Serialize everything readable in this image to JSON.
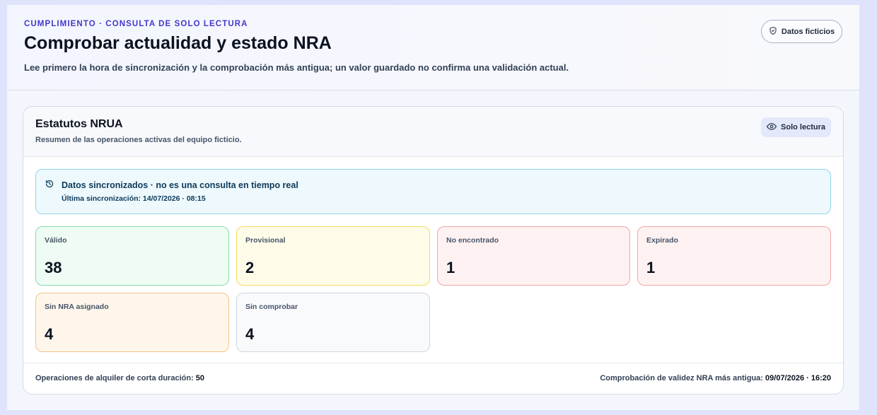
{
  "header": {
    "eyebrow": "CUMPLIMIENTO · CONSULTA DE SOLO LECTURA",
    "title": "Comprobar actualidad y estado NRA",
    "subtitle": "Lee primero la hora de sincronización y la comprobación más antigua; un valor guardado no confirma una validación actual.",
    "data_badge": "Datos ficticios",
    "data_badge_icon": "shield-icon"
  },
  "card": {
    "title": "Estatutos NRUA",
    "subtitle": "Resumen de las operaciones activas del equipo ficticio.",
    "read_only_badge": "Solo lectura",
    "read_only_icon": "eye-icon",
    "sync": {
      "icon": "history-icon",
      "title": "Datos sincronizados · no es una consulta en tiempo real",
      "last_sync": "Última sincronización: 14/07/2026 · 08:15"
    },
    "stats": [
      {
        "label": "Válido",
        "value": "38",
        "status": "valid",
        "color": "#22c55e"
      },
      {
        "label": "Provisional",
        "value": "2",
        "status": "provisional",
        "color": "#eab308"
      },
      {
        "label": "No encontrado",
        "value": "1",
        "status": "not-found",
        "color": "#ef4444"
      },
      {
        "label": "Expirado",
        "value": "1",
        "status": "expired",
        "color": "#ef4444"
      },
      {
        "label": "Sin NRA asignado",
        "value": "4",
        "status": "unassigned",
        "color": "#f97316"
      },
      {
        "label": "Sin comprobar",
        "value": "4",
        "status": "unchecked",
        "color": "#94a3b8"
      }
    ],
    "footer": {
      "operations_label": "Operaciones de alquiler de corta duración:",
      "operations_value": "50",
      "oldest_check_label": "Comprobación de validez NRA más antigua:",
      "oldest_check_value": "09/07/2026 · 16:20"
    }
  },
  "colors": {
    "accent": "#4338ca",
    "sync_border": "#8fd6e6",
    "sync_bg": "#eef9fd"
  }
}
